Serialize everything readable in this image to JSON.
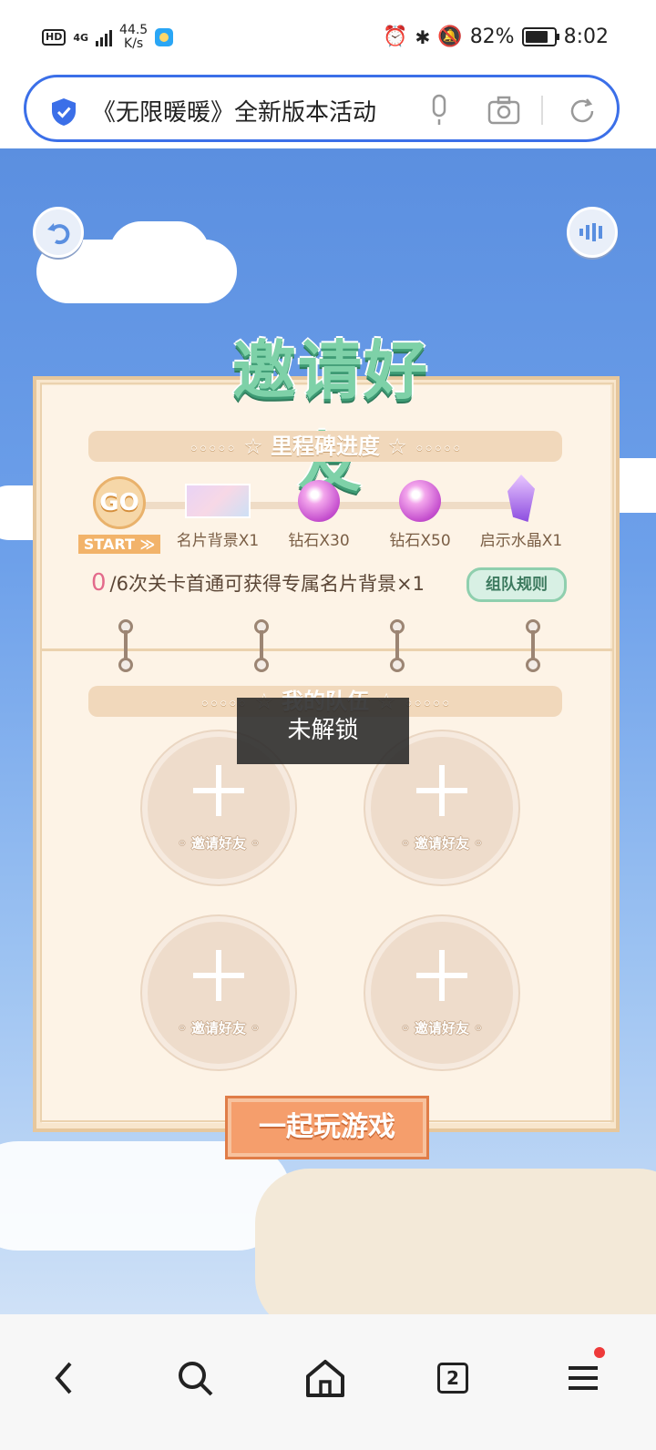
{
  "status_bar": {
    "hd": "HD",
    "network": "4G",
    "speed_value": "44.5",
    "speed_unit": "K/s",
    "battery": "82%",
    "time": "8:02"
  },
  "browser": {
    "url_text": "《无限暖暖》全新版本活动"
  },
  "game": {
    "title": "邀请好友",
    "milestone_section_title": "里程碑进度",
    "milestones": [
      {
        "label": "START ≫",
        "icon": "go-badge"
      },
      {
        "label": "名片背景X1",
        "icon": "namecard-image"
      },
      {
        "label": "钻石X30",
        "icon": "diamond"
      },
      {
        "label": "钻石X50",
        "icon": "diamond"
      },
      {
        "label": "启示水晶X1",
        "icon": "crystal"
      }
    ],
    "go_text": "GO",
    "progress_count": "0",
    "progress_text": "/6次关卡首通可获得专属名片背景×1",
    "rules_button": "组队规则",
    "team_section_title": "我的队伍",
    "invite_slots": [
      {
        "label": "邀请好友"
      },
      {
        "label": "邀请好友"
      },
      {
        "label": "邀请好友"
      },
      {
        "label": "邀请好友"
      }
    ],
    "play_button": "一起玩游戏",
    "toast": "未解锁"
  },
  "navbar": {
    "tab_count": "2"
  },
  "colors": {
    "accent": "#3b6fe8",
    "title_green": "#7ed1a8",
    "play_orange": "#f59e6c",
    "notice_red": "#ee3a3a"
  }
}
